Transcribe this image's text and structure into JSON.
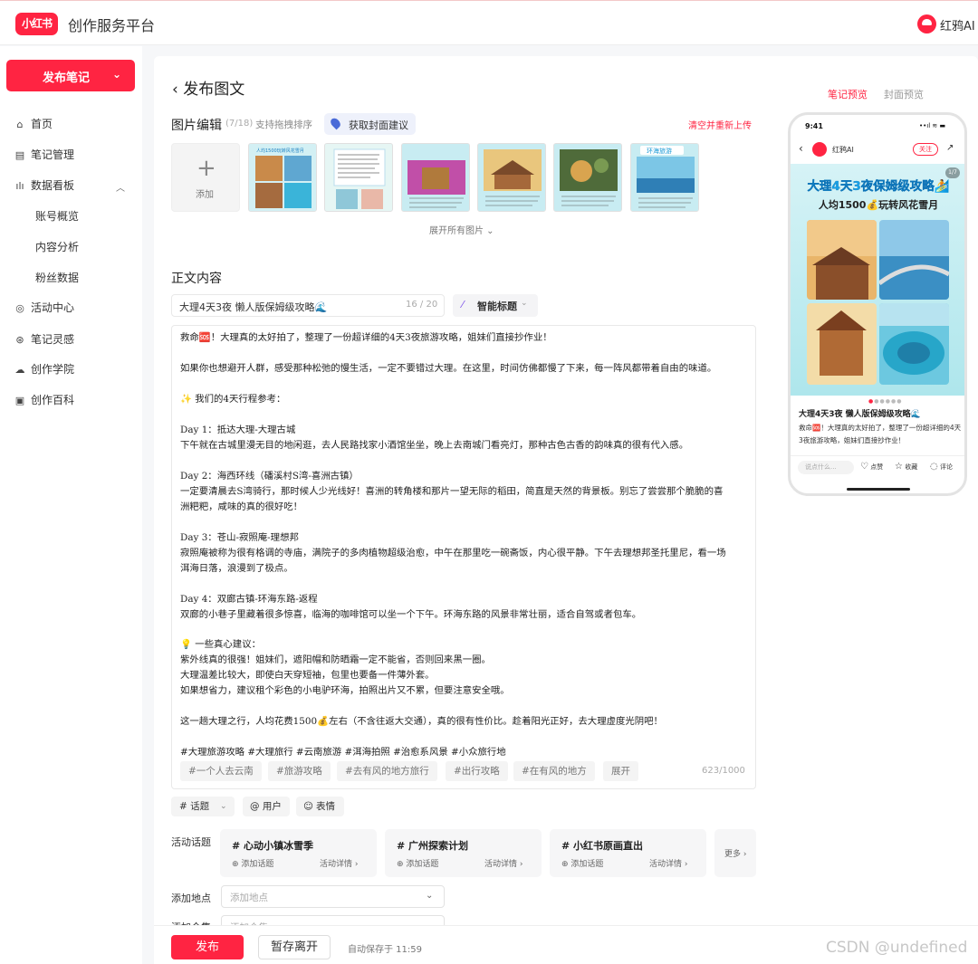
{
  "header": {
    "logo": "小红书",
    "platform": "创作服务平台",
    "ai_name": "红鸦AI"
  },
  "sidebar": {
    "publish_label": "发布笔记",
    "items": [
      {
        "label": "首页",
        "icon": "home-icon"
      },
      {
        "label": "笔记管理",
        "icon": "note-icon"
      },
      {
        "label": "数据看板",
        "icon": "chart-icon"
      },
      {
        "label": "账号概览"
      },
      {
        "label": "内容分析"
      },
      {
        "label": "粉丝数据"
      },
      {
        "label": "活动中心",
        "icon": "activity-icon"
      },
      {
        "label": "笔记灵感",
        "icon": "idea-icon"
      },
      {
        "label": "创作学院",
        "icon": "academy-icon"
      },
      {
        "label": "创作百科",
        "icon": "wiki-icon"
      }
    ]
  },
  "page": {
    "title": "发布图文",
    "tab_note_preview": "笔记预览",
    "tab_cover_preview": "封面预览"
  },
  "images": {
    "title": "图片编辑",
    "count": "(7/18)",
    "hint": "支持拖拽排序",
    "cover_btn": "获取封面建议",
    "clear": "清空并重新上传",
    "add": "添加",
    "expand": "展开所有图片",
    "thumb_captions": [
      "人均1500玩转风花雪月",
      "",
      "",
      "",
      "",
      "",
      "环海旅游"
    ]
  },
  "content": {
    "title": "正文内容",
    "note_title": "大理4天3夜 懒人版保姆级攻略🌊",
    "title_count": "16 / 20",
    "smart_title": "智能标题",
    "lines": [
      "救命🆘！大理真的太好拍了，整理了一份超详细的4天3夜旅游攻略，姐妹们直接抄作业！",
      "如果你也想避开人群，感受那种松弛的慢生活，一定不要错过大理。在这里，时间仿佛都慢了下来，每一阵风都带着自由的味道。",
      "✨ 我们的4天行程参考：",
      "Day 1：抵达大理-大理古城",
      "下午就在古城里漫无目的地闲逛，去人民路找家小酒馆坐坐，晚上去南城门看亮灯，那种古色古香的韵味真的很有代入感。",
      "Day 2：海西环线（磻溪村S湾-喜洲古镇）",
      "一定要清晨去S湾骑行，那时候人少光线好！喜洲的转角楼和那片一望无际的稻田，简直是天然的背景板。别忘了尝尝那个脆脆的喜",
      "洲粑粑，咸味的真的很好吃！",
      "Day 3：苍山-寂照庵-理想邦",
      "寂照庵被称为很有格调的寺庙，满院子的多肉植物超级治愈，中午在那里吃一碗斋饭，内心很平静。下午去理想邦圣托里尼，看一场",
      "洱海日落，浪漫到了极点。",
      "Day 4：双廊古镇-环海东路-返程",
      "双廊的小巷子里藏着很多惊喜，临海的咖啡馆可以坐一个下午。环海东路的风景非常壮丽，适合自驾或者包车。",
      "💡 一些真心建议：",
      "紫外线真的很强！姐妹们，遮阳帽和防晒霜一定不能省，否则回来黑一圈。",
      "大理温差比较大，即使白天穿短袖，包里也要备一件薄外套。",
      "如果想省力，建议租个彩色的小电驴环海，拍照出片又不累，但要注意安全哦。",
      "这一趟大理之行，人均花费1500💰左右（不含往返大交通），真的很有性价比。趁着阳光正好，去大理虚度光阴吧！",
      "#大理旅游攻略 #大理旅行 #云南旅游 #洱海拍照 #治愈系风景 #小众旅行地"
    ],
    "suggested_tags": [
      "#一个人去云南",
      "#旅游攻略",
      "#去有风的地方旅行",
      "#出行攻略",
      "#在有风的地方",
      "展开"
    ],
    "word_count": "623/1000",
    "tools": {
      "topic": "# 话题",
      "user": "@ 用户",
      "emoji": "表情"
    }
  },
  "activity": {
    "label": "活动话题",
    "topics": [
      {
        "name": "# 心动小镇冰雪季",
        "add": "⊕ 添加话题",
        "detail": "活动详情 ›"
      },
      {
        "name": "# 广州探索计划",
        "add": "⊕ 添加话题",
        "detail": "活动详情 ›"
      },
      {
        "name": "# 小红书原画直出",
        "add": "⊕ 添加话题",
        "detail": "活动详情 ›"
      }
    ],
    "more": "更多 ›"
  },
  "location": {
    "label": "添加地点",
    "placeholder": "添加地点"
  },
  "collection": {
    "label": "添加合集",
    "placeholder": "添加合集"
  },
  "footer": {
    "publish": "发布",
    "save_leave": "暂存离开",
    "autosave": "自动保存于 11:59"
  },
  "watermark": "CSDN @undefined",
  "phone": {
    "time": "9:41",
    "status": "••ıl ≋ ▬",
    "user": "红鸦AI",
    "follow": "关注",
    "headline": "大理4天3夜保姆级攻略🏄",
    "subline": "人均1500💰玩转风花雪月",
    "page": "1/7",
    "title": "大理4天3夜 懒人版保姆级攻略🌊",
    "body": "救命🆘！大理真的太好拍了，整理了一份超详细的4天3夜旅游攻略，姐妹们直接抄作业！",
    "say": "说点什么...",
    "like": "点赞",
    "collect": "收藏",
    "comment": "评论"
  },
  "colors": {
    "brand": "#ff2442",
    "ai_purple": "#7a4de8",
    "cover_blue": "#4a6bd8"
  }
}
